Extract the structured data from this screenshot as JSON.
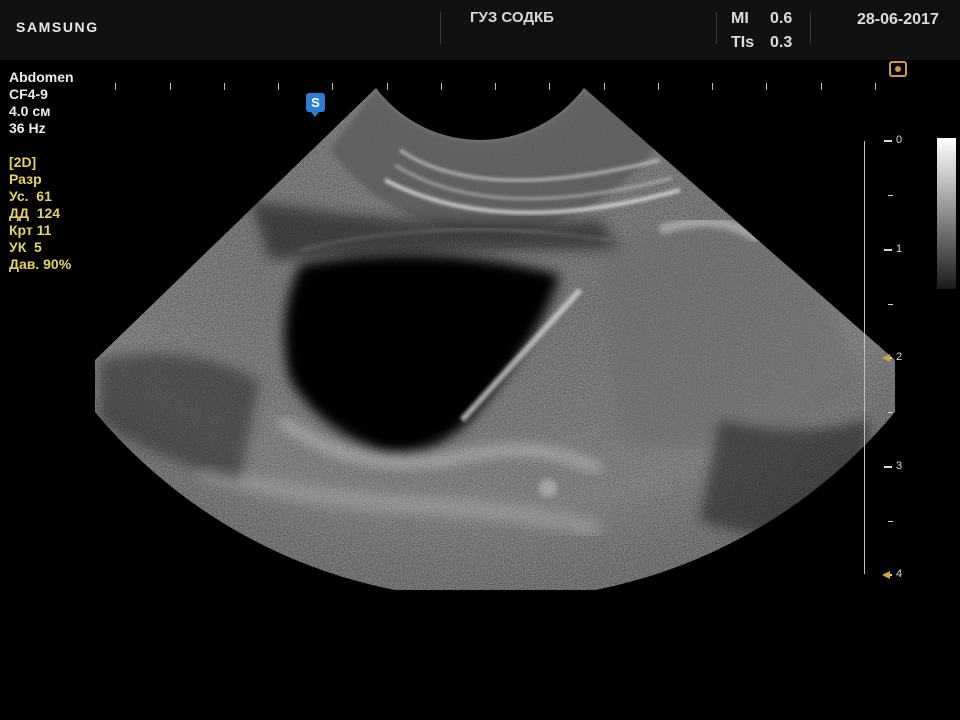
{
  "header": {
    "brand": "SAMSUNG",
    "hospital": "ГУЗ СОДКБ",
    "mi_label": "MI",
    "mi_value": "0.6",
    "tis_label": "TIs",
    "tis_value": "0.3",
    "date": "28-06-2017"
  },
  "params": {
    "preset": "Abdomen",
    "probe": "CF4-9",
    "depth": "4.0 см",
    "frame_rate": "36 Hz",
    "mode": "[2D]",
    "resolution": "Разр",
    "gain": "Ус.  61",
    "dynamic_range": "ДД  124",
    "persistence": "Крт 11",
    "edge": "УК  5",
    "power": "Дав. 90%"
  },
  "marker": {
    "s_label": "S"
  },
  "depth_scale": {
    "labels": [
      "0",
      "1",
      "2",
      "3",
      "4"
    ],
    "focus_depths": [
      2,
      4
    ]
  },
  "colors": {
    "param_white": "#ececec",
    "param_yellow": "#e6d35e",
    "marker_blue": "#2a7fd4",
    "focus_gold": "#d2a63a"
  },
  "icons": {
    "orientation": "probe-orientation-icon",
    "s_marker": "s-marker-icon"
  }
}
